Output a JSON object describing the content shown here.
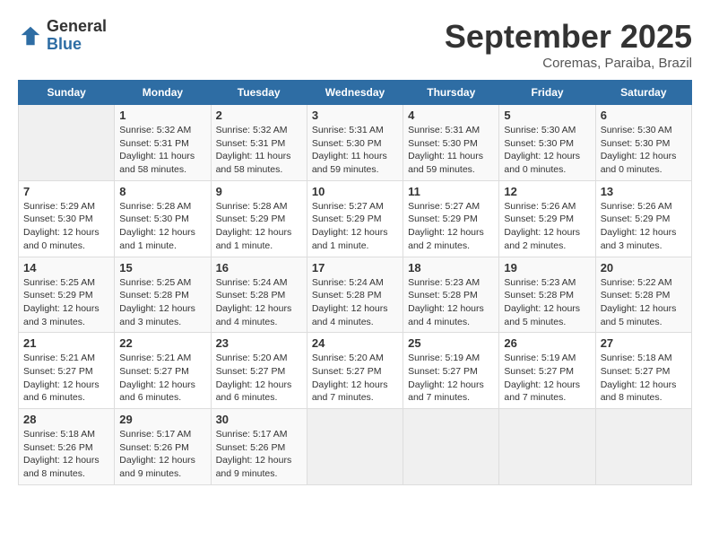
{
  "logo": {
    "general": "General",
    "blue": "Blue"
  },
  "title": "September 2025",
  "location": "Coremas, Paraiba, Brazil",
  "headers": [
    "Sunday",
    "Monday",
    "Tuesday",
    "Wednesday",
    "Thursday",
    "Friday",
    "Saturday"
  ],
  "weeks": [
    [
      {
        "day": "",
        "info": ""
      },
      {
        "day": "1",
        "info": "Sunrise: 5:32 AM\nSunset: 5:31 PM\nDaylight: 11 hours\nand 58 minutes."
      },
      {
        "day": "2",
        "info": "Sunrise: 5:32 AM\nSunset: 5:31 PM\nDaylight: 11 hours\nand 58 minutes."
      },
      {
        "day": "3",
        "info": "Sunrise: 5:31 AM\nSunset: 5:30 PM\nDaylight: 11 hours\nand 59 minutes."
      },
      {
        "day": "4",
        "info": "Sunrise: 5:31 AM\nSunset: 5:30 PM\nDaylight: 11 hours\nand 59 minutes."
      },
      {
        "day": "5",
        "info": "Sunrise: 5:30 AM\nSunset: 5:30 PM\nDaylight: 12 hours\nand 0 minutes."
      },
      {
        "day": "6",
        "info": "Sunrise: 5:30 AM\nSunset: 5:30 PM\nDaylight: 12 hours\nand 0 minutes."
      }
    ],
    [
      {
        "day": "7",
        "info": "Sunrise: 5:29 AM\nSunset: 5:30 PM\nDaylight: 12 hours\nand 0 minutes."
      },
      {
        "day": "8",
        "info": "Sunrise: 5:28 AM\nSunset: 5:30 PM\nDaylight: 12 hours\nand 1 minute."
      },
      {
        "day": "9",
        "info": "Sunrise: 5:28 AM\nSunset: 5:29 PM\nDaylight: 12 hours\nand 1 minute."
      },
      {
        "day": "10",
        "info": "Sunrise: 5:27 AM\nSunset: 5:29 PM\nDaylight: 12 hours\nand 1 minute."
      },
      {
        "day": "11",
        "info": "Sunrise: 5:27 AM\nSunset: 5:29 PM\nDaylight: 12 hours\nand 2 minutes."
      },
      {
        "day": "12",
        "info": "Sunrise: 5:26 AM\nSunset: 5:29 PM\nDaylight: 12 hours\nand 2 minutes."
      },
      {
        "day": "13",
        "info": "Sunrise: 5:26 AM\nSunset: 5:29 PM\nDaylight: 12 hours\nand 3 minutes."
      }
    ],
    [
      {
        "day": "14",
        "info": "Sunrise: 5:25 AM\nSunset: 5:29 PM\nDaylight: 12 hours\nand 3 minutes."
      },
      {
        "day": "15",
        "info": "Sunrise: 5:25 AM\nSunset: 5:28 PM\nDaylight: 12 hours\nand 3 minutes."
      },
      {
        "day": "16",
        "info": "Sunrise: 5:24 AM\nSunset: 5:28 PM\nDaylight: 12 hours\nand 4 minutes."
      },
      {
        "day": "17",
        "info": "Sunrise: 5:24 AM\nSunset: 5:28 PM\nDaylight: 12 hours\nand 4 minutes."
      },
      {
        "day": "18",
        "info": "Sunrise: 5:23 AM\nSunset: 5:28 PM\nDaylight: 12 hours\nand 4 minutes."
      },
      {
        "day": "19",
        "info": "Sunrise: 5:23 AM\nSunset: 5:28 PM\nDaylight: 12 hours\nand 5 minutes."
      },
      {
        "day": "20",
        "info": "Sunrise: 5:22 AM\nSunset: 5:28 PM\nDaylight: 12 hours\nand 5 minutes."
      }
    ],
    [
      {
        "day": "21",
        "info": "Sunrise: 5:21 AM\nSunset: 5:27 PM\nDaylight: 12 hours\nand 6 minutes."
      },
      {
        "day": "22",
        "info": "Sunrise: 5:21 AM\nSunset: 5:27 PM\nDaylight: 12 hours\nand 6 minutes."
      },
      {
        "day": "23",
        "info": "Sunrise: 5:20 AM\nSunset: 5:27 PM\nDaylight: 12 hours\nand 6 minutes."
      },
      {
        "day": "24",
        "info": "Sunrise: 5:20 AM\nSunset: 5:27 PM\nDaylight: 12 hours\nand 7 minutes."
      },
      {
        "day": "25",
        "info": "Sunrise: 5:19 AM\nSunset: 5:27 PM\nDaylight: 12 hours\nand 7 minutes."
      },
      {
        "day": "26",
        "info": "Sunrise: 5:19 AM\nSunset: 5:27 PM\nDaylight: 12 hours\nand 7 minutes."
      },
      {
        "day": "27",
        "info": "Sunrise: 5:18 AM\nSunset: 5:27 PM\nDaylight: 12 hours\nand 8 minutes."
      }
    ],
    [
      {
        "day": "28",
        "info": "Sunrise: 5:18 AM\nSunset: 5:26 PM\nDaylight: 12 hours\nand 8 minutes."
      },
      {
        "day": "29",
        "info": "Sunrise: 5:17 AM\nSunset: 5:26 PM\nDaylight: 12 hours\nand 9 minutes."
      },
      {
        "day": "30",
        "info": "Sunrise: 5:17 AM\nSunset: 5:26 PM\nDaylight: 12 hours\nand 9 minutes."
      },
      {
        "day": "",
        "info": ""
      },
      {
        "day": "",
        "info": ""
      },
      {
        "day": "",
        "info": ""
      },
      {
        "day": "",
        "info": ""
      }
    ]
  ]
}
